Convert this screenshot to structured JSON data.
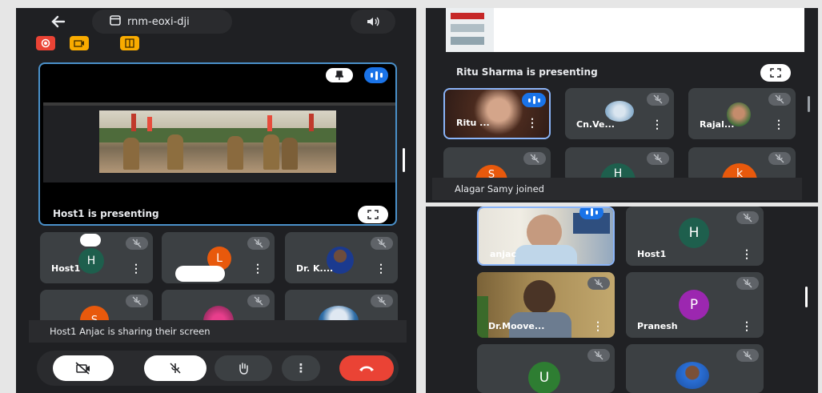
{
  "meeting": {
    "code": "rnm-eoxi-dji"
  },
  "left_panel": {
    "main_stage": {
      "caption": "Host1 is presenting"
    },
    "tiles": [
      {
        "name": "Host1",
        "initial": "H",
        "avatar_color": "#1e5f4d"
      },
      {
        "name": "",
        "initial": "L",
        "avatar_color": "#e8590c"
      },
      {
        "name": "Dr. K...."
      },
      {
        "name": "",
        "initial": "S",
        "avatar_color": "#e8590c"
      }
    ],
    "toast": "Host1 Anjac is sharing their screen",
    "more_label": "⋮"
  },
  "top_right_panel": {
    "caption": "Ritu Sharma is presenting",
    "tiles": [
      {
        "name": "Ritu ..."
      },
      {
        "name": "Cn.Ve..."
      },
      {
        "name": "Rajal..."
      },
      {
        "name": "",
        "initial": "S",
        "avatar_color": "#e8590c"
      },
      {
        "name": "",
        "initial": "H",
        "avatar_color": "#1e5f4d"
      },
      {
        "name": "",
        "initial": "k",
        "avatar_color": "#e8590c"
      }
    ],
    "toast": "Alagar Samy joined"
  },
  "bottom_right_panel": {
    "tiles": [
      {
        "name": "anjac"
      },
      {
        "name": "Host1",
        "initial": "H",
        "avatar_color": "#1e5f4d"
      },
      {
        "name": "Dr.Moove..."
      },
      {
        "name": "Pranesh",
        "initial": "P",
        "avatar_color": "#9c27b0"
      },
      {
        "name": "",
        "initial": "U",
        "avatar_color": "#2e7d32"
      },
      {
        "name": ""
      }
    ]
  },
  "colors": {
    "accent_blue": "#8ab4f8",
    "end_call_red": "#ea4335",
    "panel_bg": "#1f2023",
    "tile_bg": "#3c4043"
  }
}
